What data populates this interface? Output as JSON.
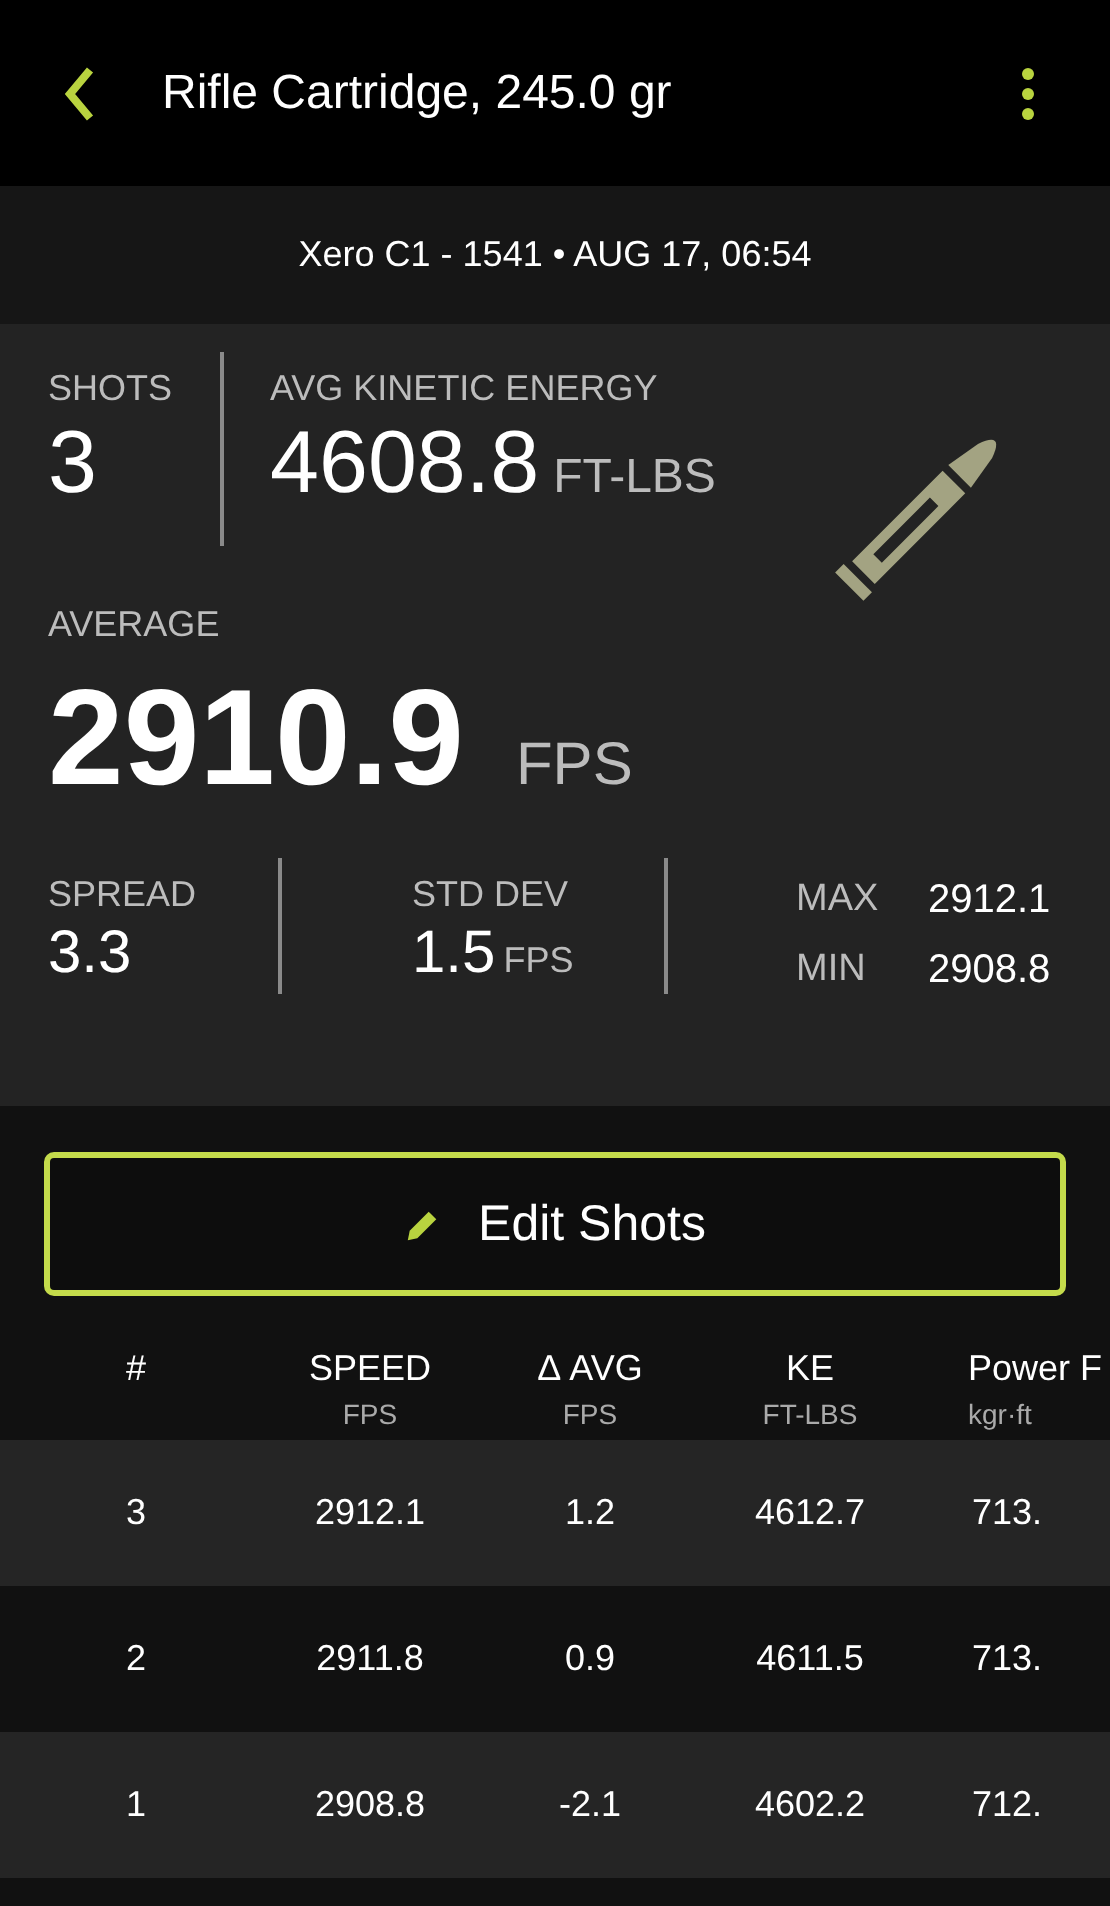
{
  "app_bar": {
    "title": "Rifle Cartridge, 245.0 gr"
  },
  "session": {
    "text": "Xero C1 - 1541 • AUG 17, 06:54"
  },
  "summary": {
    "shots_label": "SHOTS",
    "shots": "3",
    "ke_label": "AVG KINETIC ENERGY",
    "ke": "4608.8",
    "ke_unit": "FT-LBS",
    "average_label": "AVERAGE",
    "average": "2910.9",
    "average_unit": "FPS",
    "spread_label": "SPREAD",
    "spread": "3.3",
    "std_dev_label": "STD DEV",
    "std_dev": "1.5",
    "std_dev_unit": "FPS",
    "max_label": "MAX",
    "max": "2912.1",
    "min_label": "MIN",
    "min": "2908.8"
  },
  "edit_button": {
    "label": "Edit Shots"
  },
  "table": {
    "columns": [
      {
        "title": "#"
      },
      {
        "title": "SPEED",
        "unit": "FPS"
      },
      {
        "title": "Δ AVG",
        "unit": "FPS"
      },
      {
        "title": "KE",
        "unit": "FT-LBS"
      },
      {
        "title": "Power F",
        "unit": "kgr·ft"
      }
    ],
    "rows": [
      [
        "3",
        "2912.1",
        "1.2",
        "4612.7",
        "713."
      ],
      [
        "2",
        "2911.8",
        "0.9",
        "4611.5",
        "713."
      ],
      [
        "1",
        "2908.8",
        "-2.1",
        "4602.2",
        "712."
      ]
    ]
  }
}
